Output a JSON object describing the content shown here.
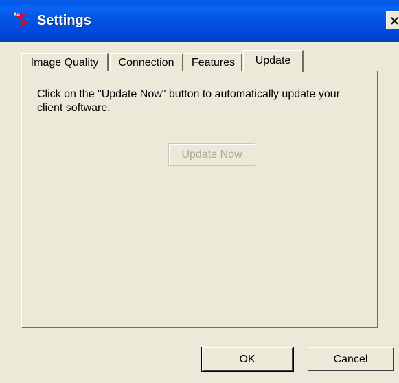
{
  "window": {
    "title": "Settings",
    "app_icon": "app-logo-icon",
    "close_icon": "close-icon",
    "close_glyph": "×"
  },
  "tabs": [
    {
      "label": "Image Quality",
      "active": false
    },
    {
      "label": "Connection",
      "active": false
    },
    {
      "label": "Features",
      "active": false
    },
    {
      "label": "Update",
      "active": true
    }
  ],
  "update_panel": {
    "instructions": "Click on the \"Update Now\" button to automatically update your client software.",
    "update_now_label": "Update Now",
    "update_now_enabled": false
  },
  "footer": {
    "ok_label": "OK",
    "cancel_label": "Cancel"
  },
  "colors": {
    "titlebar": "#0054e3",
    "dialog_face": "#ece9d8",
    "disabled_text": "#aca899"
  }
}
